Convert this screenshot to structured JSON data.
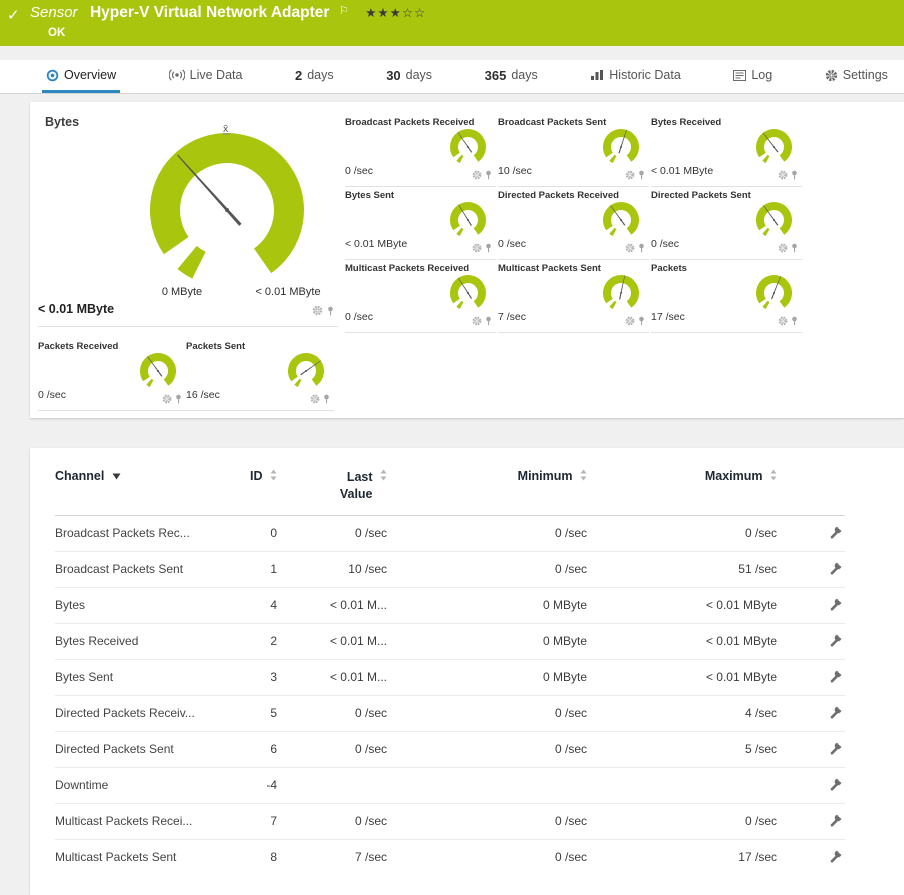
{
  "colors": {
    "brand_green": "#a9c50e",
    "accent_blue": "#2d87c3",
    "needle": "#555555"
  },
  "header": {
    "check": "✓",
    "kind": "Sensor",
    "title": "Hyper-V Virtual Network Adapter",
    "flag": "⚐",
    "stars": "★★★☆☆",
    "status": "OK"
  },
  "tabs": [
    {
      "label": "Overview",
      "icon": "overview-icon",
      "active": true
    },
    {
      "label": "Live Data",
      "icon": "live-data-icon"
    },
    {
      "num": "2",
      "label": "days"
    },
    {
      "num": "30",
      "label": "days"
    },
    {
      "num": "365",
      "label": "days"
    },
    {
      "label": "Historic Data",
      "icon": "historic-data-icon"
    },
    {
      "label": "Log",
      "icon": "log-icon"
    },
    {
      "label": "Settings",
      "icon": "settings-icon"
    }
  ],
  "main_gauge": {
    "label": "Bytes",
    "mean_label": "x̄",
    "scale_min": "0 MByte",
    "scale_max": "< 0.01 MByte",
    "value": "< 0.01 MByte",
    "needle_deg": -42
  },
  "mini_gauges": [
    {
      "title": "Broadcast Packets Received",
      "value": "0 /sec",
      "needle_deg": -35
    },
    {
      "title": "Broadcast Packets Sent",
      "value": "10 /sec",
      "needle_deg": 18
    },
    {
      "title": "Bytes Received",
      "value": "< 0.01 MByte",
      "needle_deg": -38
    },
    {
      "title": "Bytes Sent",
      "value": "< 0.01 MByte",
      "needle_deg": -32
    },
    {
      "title": "Directed Packets Received",
      "value": "0 /sec",
      "needle_deg": -36
    },
    {
      "title": "Directed Packets Sent",
      "value": "0 /sec",
      "needle_deg": -36
    },
    {
      "title": "Multicast Packets Received",
      "value": "0 /sec",
      "needle_deg": -33
    },
    {
      "title": "Multicast Packets Sent",
      "value": "7 /sec",
      "needle_deg": 12
    },
    {
      "title": "Packets",
      "value": "17 /sec",
      "needle_deg": 22
    }
  ],
  "bottom_gauges": [
    {
      "title": "Packets Received",
      "value": "0 /sec",
      "needle_deg": -36
    },
    {
      "title": "Packets Sent",
      "value": "16 /sec",
      "needle_deg": 55
    }
  ],
  "table": {
    "headers": {
      "channel": "Channel",
      "id": "ID",
      "last_value": "Last Value",
      "minimum": "Minimum",
      "maximum": "Maximum"
    },
    "rows": [
      {
        "channel": "Broadcast Packets Rec...",
        "id": "0",
        "last": "0 /sec",
        "min": "0 /sec",
        "max": "0 /sec"
      },
      {
        "channel": "Broadcast Packets Sent",
        "id": "1",
        "last": "10 /sec",
        "min": "0 /sec",
        "max": "51 /sec"
      },
      {
        "channel": "Bytes",
        "id": "4",
        "last": "< 0.01 M...",
        "min": "0 MByte",
        "max": "< 0.01 MByte"
      },
      {
        "channel": "Bytes Received",
        "id": "2",
        "last": "< 0.01 M...",
        "min": "0 MByte",
        "max": "< 0.01 MByte"
      },
      {
        "channel": "Bytes Sent",
        "id": "3",
        "last": "< 0.01 M...",
        "min": "0 MByte",
        "max": "< 0.01 MByte"
      },
      {
        "channel": "Directed Packets Receiv...",
        "id": "5",
        "last": "0 /sec",
        "min": "0 /sec",
        "max": "4 /sec"
      },
      {
        "channel": "Directed Packets Sent",
        "id": "6",
        "last": "0 /sec",
        "min": "0 /sec",
        "max": "5 /sec"
      },
      {
        "channel": "Downtime",
        "id": "-4",
        "last": "",
        "min": "",
        "max": ""
      },
      {
        "channel": "Multicast Packets Recei...",
        "id": "7",
        "last": "0 /sec",
        "min": "0 /sec",
        "max": "0 /sec"
      },
      {
        "channel": "Multicast Packets Sent",
        "id": "8",
        "last": "7 /sec",
        "min": "0 /sec",
        "max": "17 /sec"
      }
    ]
  }
}
